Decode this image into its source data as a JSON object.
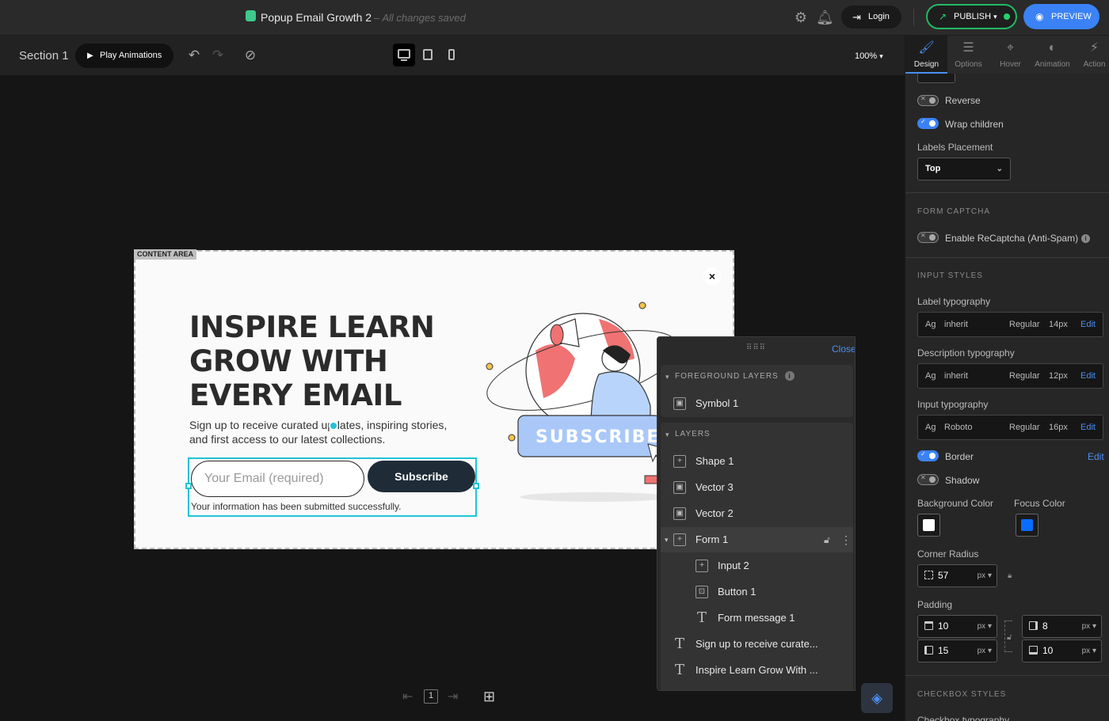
{
  "topbar": {
    "project_title": "Popup Email Growth 2",
    "save_status": "– All changes saved",
    "login_label": "Login",
    "publish_label": "PUBLISH",
    "preview_label": "PREVIEW"
  },
  "toolbar": {
    "section_label": "Section 1",
    "play_animations_label": "Play Animations",
    "zoom": "100%"
  },
  "canvas": {
    "content_area_tag": "CONTENT AREA",
    "popup": {
      "close_glyph": "×",
      "headline": "INSPIRE LEARN GROW WITH EVERY EMAIL",
      "subtext": "Sign up to receive curated updates, inspiring stories, and first access to our latest collections.",
      "email_placeholder": "Your Email (required)",
      "subscribe_label": "Subscribe",
      "form_message": "Your information has been submitted successfully.",
      "illustration_button_text": "SUBSCRIBE"
    },
    "page_number": "1"
  },
  "layers_panel": {
    "close_label": "Close",
    "foreground_title": "FOREGROUND LAYERS",
    "foreground_items": [
      {
        "label": "Symbol 1",
        "icon": "image-icon"
      }
    ],
    "layers_title": "LAYERS",
    "items": [
      {
        "label": "Shape 1",
        "icon": "container-icon"
      },
      {
        "label": "Vector 3",
        "icon": "image-icon"
      },
      {
        "label": "Vector 2",
        "icon": "image-icon"
      },
      {
        "label": "Form 1",
        "icon": "container-icon",
        "selected": true
      },
      {
        "label": "Input 2",
        "icon": "container-icon"
      },
      {
        "label": "Button 1",
        "icon": "button-icon"
      },
      {
        "label": "Form message 1",
        "icon": "text-icon"
      },
      {
        "label": "Sign up to receive curate...",
        "icon": "text-icon"
      },
      {
        "label": "Inspire Learn Grow With ...",
        "icon": "text-icon"
      }
    ]
  },
  "right_panel": {
    "tabs": [
      {
        "label": "Design",
        "icon": "brush-icon",
        "active": true
      },
      {
        "label": "Options",
        "icon": "sliders-icon"
      },
      {
        "label": "Hover",
        "icon": "cursor-icon"
      },
      {
        "label": "Animation",
        "icon": "animation-icon"
      },
      {
        "label": "Action",
        "icon": "bolt-icon"
      }
    ],
    "reverse_label": "Reverse",
    "reverse_on": false,
    "wrap_children_label": "Wrap children",
    "wrap_children_on": true,
    "labels_placement_label": "Labels Placement",
    "labels_placement_value": "Top",
    "form_captcha_title": "FORM CAPTCHA",
    "recaptcha_label": "Enable ReCaptcha (Anti-Spam)",
    "recaptcha_on": false,
    "input_styles_title": "INPUT STYLES",
    "label_typography": {
      "title": "Label typography",
      "sample": "Ag",
      "font": "inherit",
      "weight": "Regular",
      "size": "14px",
      "edit": "Edit"
    },
    "description_typography": {
      "title": "Description typography",
      "sample": "Ag",
      "font": "inherit",
      "weight": "Regular",
      "size": "12px",
      "edit": "Edit"
    },
    "input_typography": {
      "title": "Input typography",
      "sample": "Ag",
      "font": "Roboto",
      "weight": "Regular",
      "size": "16px",
      "edit": "Edit"
    },
    "border_label": "Border",
    "border_on": true,
    "border_edit": "Edit",
    "shadow_label": "Shadow",
    "shadow_on": false,
    "background_color_label": "Background Color",
    "background_color": "#ffffff",
    "focus_color_label": "Focus Color",
    "focus_color": "#0a6cff",
    "corner_radius_label": "Corner Radius",
    "corner_radius_value": "57",
    "corner_radius_unit": "px",
    "padding_label": "Padding",
    "padding": {
      "top": "10",
      "right": "8",
      "left": "15",
      "bottom": "10",
      "unit": "px"
    },
    "checkbox_styles_title": "CHECKBOX STYLES",
    "checkbox_typography_label": "Checkbox typography"
  },
  "colors": {
    "accent": "#3b82f6",
    "publish_green": "#22b964",
    "selection_cyan": "#22c3d6"
  }
}
